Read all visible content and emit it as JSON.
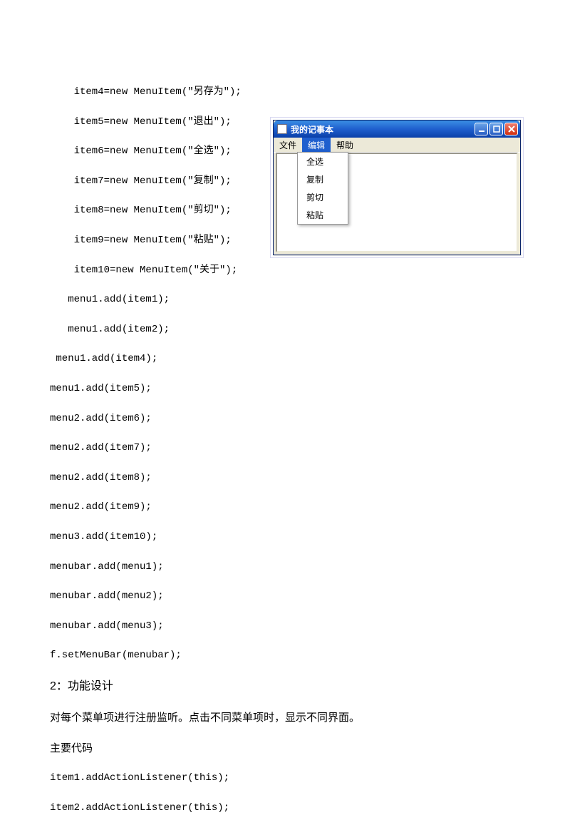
{
  "code": {
    "l1": "    item4=new MenuItem(\"另存为\");",
    "l2": "    item5=new MenuItem(\"退出\");",
    "l3": "    item6=new MenuItem(\"全选\");",
    "l4": "    item7=new MenuItem(\"复制\");",
    "l5": "    item8=new MenuItem(\"剪切\");",
    "l6": "    item9=new MenuItem(\"粘贴\");",
    "l7": "    item10=new MenuItem(\"关于\");",
    "l8": "   menu1.add(item1);",
    "l9": "   menu1.add(item2);",
    "l10": " menu1.add(item4);",
    "l11": "menu1.add(item5);",
    "l12": "menu2.add(item6);",
    "l13": "menu2.add(item7);",
    "l14": "menu2.add(item8);",
    "l15": "menu2.add(item9);",
    "l16": "menu3.add(item10);",
    "l17": "menubar.add(menu1);",
    "l18": "menubar.add(menu2);",
    "l19": "menubar.add(menu3);",
    "l20": "f.setMenuBar(menubar);"
  },
  "heading": "2：功能设计",
  "para1": "对每个菜单项进行注册监听。点击不同菜单项时，显示不同界面。",
  "para2": "主要代码",
  "code2": {
    "l1": "item1.addActionListener(this);",
    "l2": "item2.addActionListener(this);"
  },
  "window": {
    "title": "我的记事本",
    "menus": {
      "file": "文件",
      "edit": "编辑",
      "help": "帮助"
    },
    "dropdown": {
      "selectAll": "全选",
      "copy": "复制",
      "cut": "剪切",
      "paste": "粘贴"
    }
  }
}
